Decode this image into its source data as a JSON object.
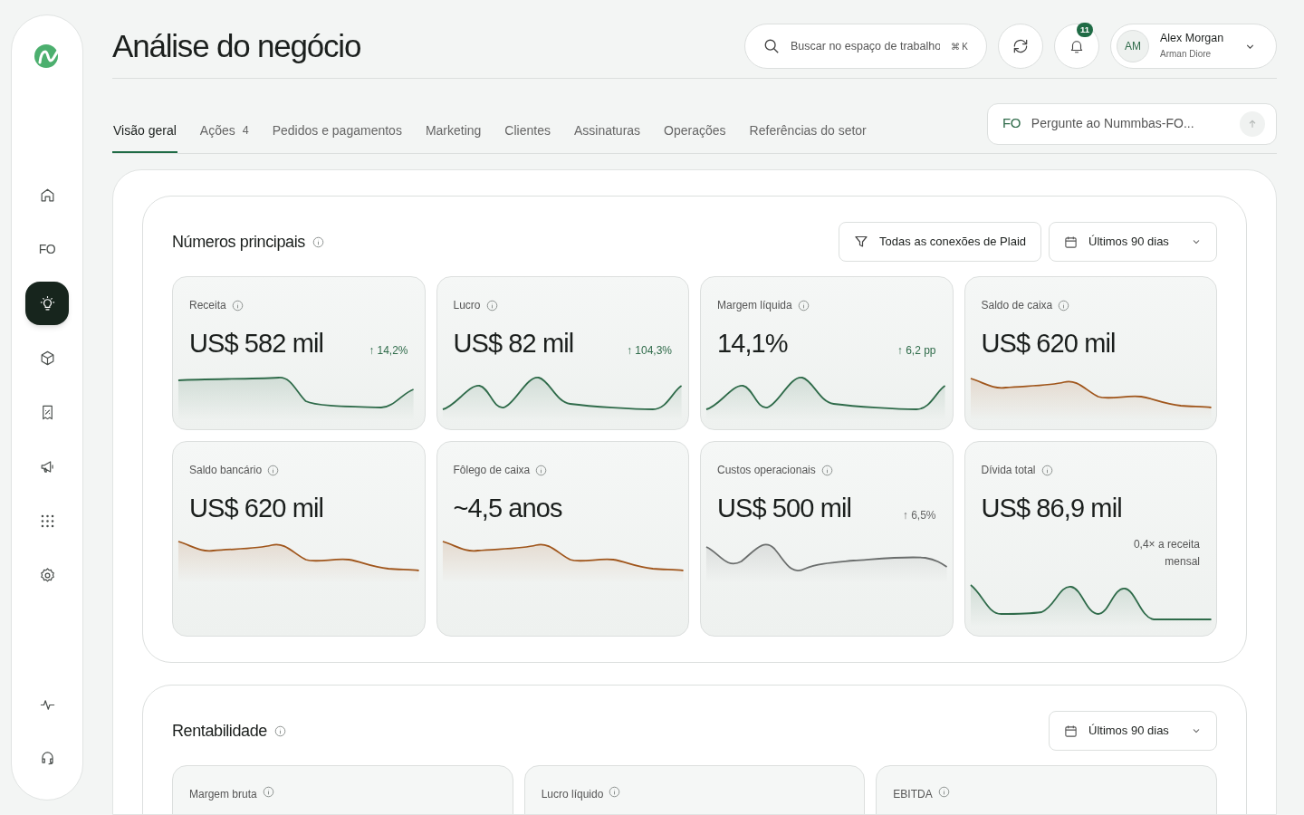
{
  "sidebar": {
    "nav": [
      {
        "kind": "home",
        "selected": false
      },
      {
        "kind": "fo",
        "label": "FO",
        "selected": false
      },
      {
        "kind": "bulb",
        "selected": true
      },
      {
        "kind": "cube",
        "selected": false
      },
      {
        "kind": "receipt",
        "selected": false
      },
      {
        "kind": "megaphone",
        "selected": false
      },
      {
        "kind": "grid",
        "selected": false
      },
      {
        "kind": "gear",
        "selected": false
      }
    ],
    "bottom": [
      {
        "kind": "pulse"
      },
      {
        "kind": "headset"
      }
    ]
  },
  "header": {
    "title": "Análise do negócio",
    "search": {
      "placeholder": "Buscar no espaço de trabalho",
      "shortcut": "⌘ K"
    },
    "notifications": "11",
    "user": {
      "initials": "AM",
      "name": "Alex Morgan",
      "company": "Arman Diore"
    }
  },
  "tabs": [
    {
      "label": "Visão geral",
      "selected": true
    },
    {
      "label": "Ações",
      "count": "4",
      "selected": false
    },
    {
      "label": "Pedidos e pagamentos",
      "selected": false
    },
    {
      "label": "Marketing",
      "selected": false
    },
    {
      "label": "Clientes",
      "selected": false
    },
    {
      "label": "Assinaturas",
      "selected": false
    },
    {
      "label": "Operações",
      "selected": false
    },
    {
      "label": "Referências do setor",
      "selected": false
    }
  ],
  "ask": {
    "mark": "FO",
    "placeholder": "Pergunte ao Nummbas-FO..."
  },
  "key_numbers": {
    "title": "Números principais",
    "filter": "Todas as conexões de Plaid",
    "period": "Últimos 90 dias",
    "cards": [
      {
        "label": "Receita",
        "value": "US$ 582 mil",
        "change": "↑ 14,2%",
        "color": "#2f6b4a",
        "kind": "plateau"
      },
      {
        "label": "Lucro",
        "value": "US$ 82 mil",
        "change": "↑ 104,3%",
        "color": "#2f6b4a",
        "kind": "peaks"
      },
      {
        "label": "Margem líquida",
        "value": "14,1%",
        "change": "↑ 6,2 pp",
        "color": "#2f6b4a",
        "kind": "peaks"
      },
      {
        "label": "Saldo de caixa",
        "value": "US$ 620 mil",
        "color": "#a0561c",
        "kind": "decline"
      },
      {
        "label": "Saldo bancário",
        "value": "US$ 620 mil",
        "color": "#a0561c",
        "kind": "decline"
      },
      {
        "label": "Fôlego de caixa",
        "value": "~4,5 anos",
        "color": "#a0561c",
        "kind": "decline"
      },
      {
        "label": "Custos operacionais",
        "value": "US$ 500 mil",
        "change": "↑ 6,5%",
        "color": "#6b6e6d",
        "kind": "wave"
      },
      {
        "label": "Dívida total",
        "value": "US$ 86,9 mil",
        "note": "0,4× a receita mensal",
        "color": "#2f6b4a",
        "kind": "humps"
      }
    ]
  },
  "profitability": {
    "title": "Rentabilidade",
    "period": "Últimos 90 dias",
    "cards": [
      {
        "label": "Margem bruta"
      },
      {
        "label": "Lucro líquido"
      },
      {
        "label": "EBITDA"
      }
    ]
  }
}
